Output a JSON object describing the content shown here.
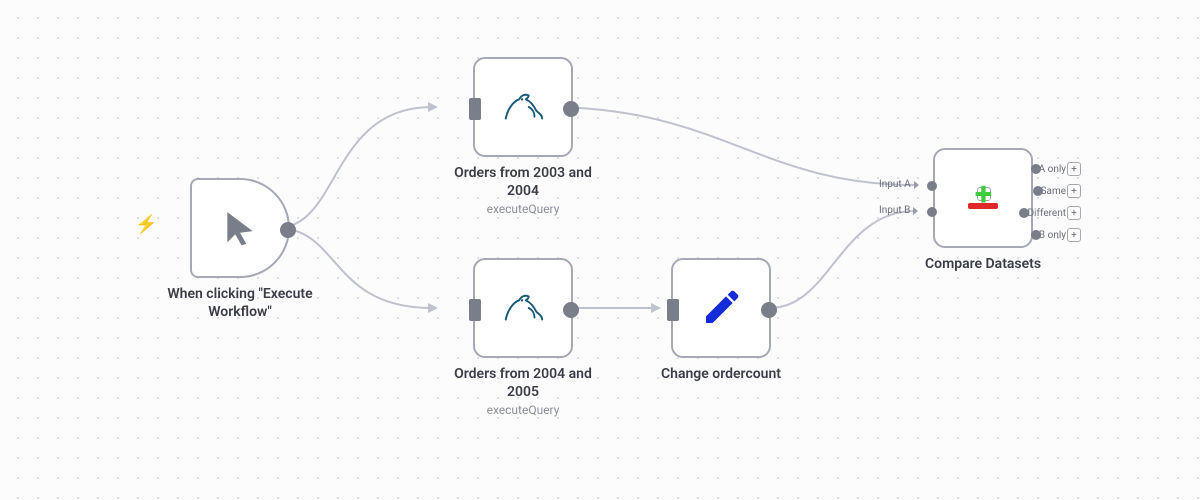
{
  "nodes": {
    "trigger": {
      "title": "When clicking \"Execute Workflow\"",
      "type": "trigger"
    },
    "query1": {
      "title": "Orders from 2003 and 2004",
      "subtitle": "executeQuery",
      "type": "mysql"
    },
    "query2": {
      "title": "Orders from 2004 and 2005",
      "subtitle": "executeQuery",
      "type": "mysql"
    },
    "change": {
      "title": "Change ordercount",
      "type": "edit"
    },
    "compare": {
      "title": "Compare Datasets",
      "type": "compare",
      "inputs": [
        "Input A",
        "Input B"
      ],
      "outputs": [
        "A only",
        "Same",
        "Different",
        "B only"
      ]
    }
  }
}
